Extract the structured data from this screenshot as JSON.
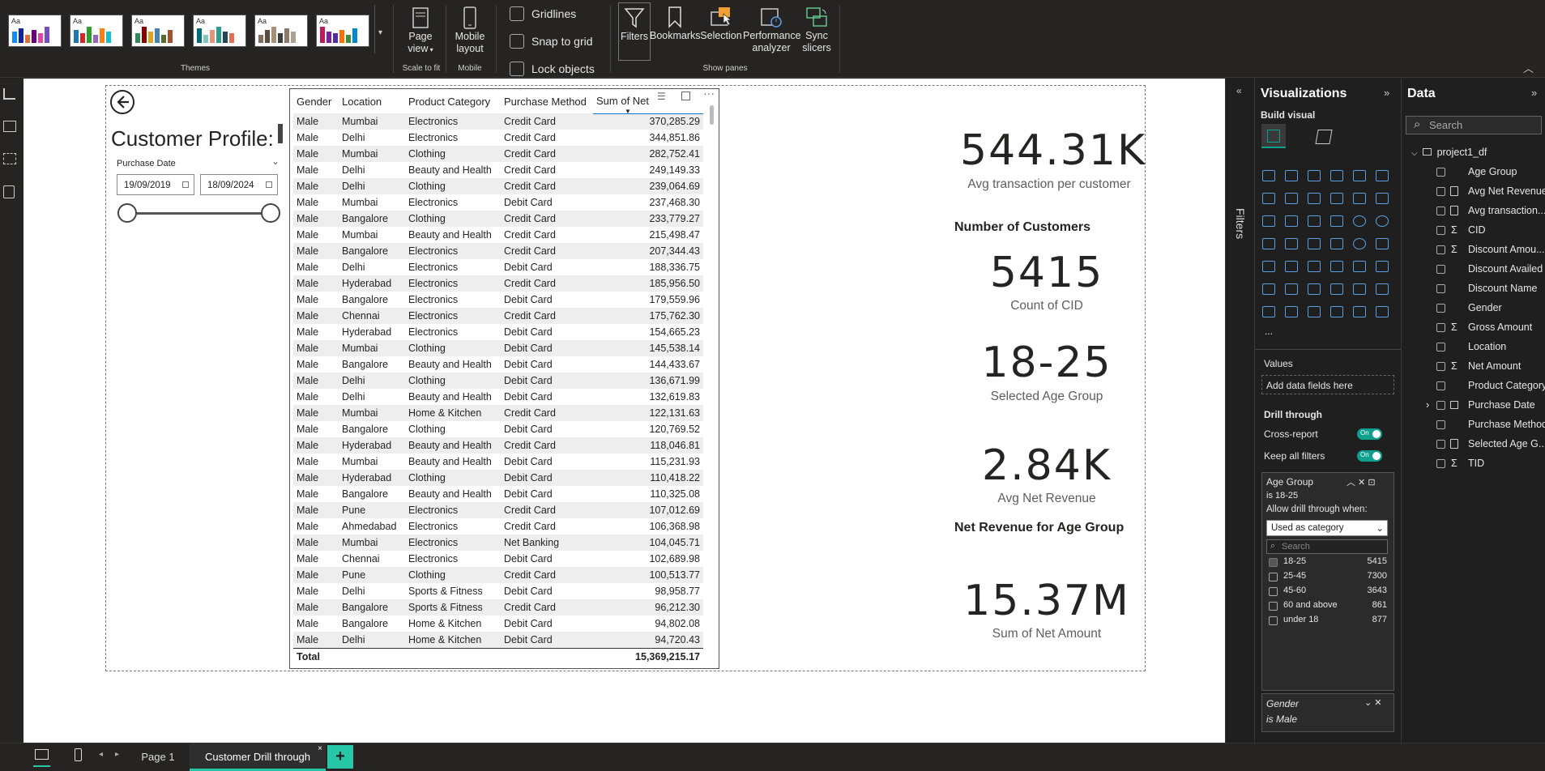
{
  "ribbon": {
    "themes_label": "Themes",
    "page_view_label": "Page view",
    "scale_label": "Scale to fit",
    "mobile_layout_label": "Mobile layout",
    "mobile_group_label": "Mobile",
    "gridlines_label": "Gridlines",
    "snap_label": "Snap to grid",
    "lock_label": "Lock objects",
    "filters_label": "Filters",
    "bookmarks_label": "Bookmarks",
    "selection_label": "Selection",
    "performance_label": "Performance analyzer",
    "sync_label": "Sync slicers",
    "show_panes_label": "Show panes",
    "theme_swatch_text": "Aa"
  },
  "report": {
    "title": "Customer Profile:",
    "slicer_label": "Purchase Date",
    "date_from": "19/09/2019",
    "date_to": "18/09/2024"
  },
  "table": {
    "headers": [
      "Gender",
      "Location",
      "Product Category",
      "Purchase Method",
      "Sum of Net"
    ],
    "rows": [
      [
        "Male",
        "Mumbai",
        "Electronics",
        "Credit Card",
        "370,285.29"
      ],
      [
        "Male",
        "Delhi",
        "Electronics",
        "Credit Card",
        "344,851.86"
      ],
      [
        "Male",
        "Mumbai",
        "Clothing",
        "Credit Card",
        "282,752.41"
      ],
      [
        "Male",
        "Delhi",
        "Beauty and Health",
        "Credit Card",
        "249,149.33"
      ],
      [
        "Male",
        "Delhi",
        "Clothing",
        "Credit Card",
        "239,064.69"
      ],
      [
        "Male",
        "Mumbai",
        "Electronics",
        "Debit Card",
        "237,468.30"
      ],
      [
        "Male",
        "Bangalore",
        "Clothing",
        "Credit Card",
        "233,779.27"
      ],
      [
        "Male",
        "Mumbai",
        "Beauty and Health",
        "Credit Card",
        "215,498.47"
      ],
      [
        "Male",
        "Bangalore",
        "Electronics",
        "Credit Card",
        "207,344.43"
      ],
      [
        "Male",
        "Delhi",
        "Electronics",
        "Debit Card",
        "188,336.75"
      ],
      [
        "Male",
        "Hyderabad",
        "Electronics",
        "Credit Card",
        "185,956.50"
      ],
      [
        "Male",
        "Bangalore",
        "Electronics",
        "Debit Card",
        "179,559.96"
      ],
      [
        "Male",
        "Chennai",
        "Electronics",
        "Credit Card",
        "175,762.30"
      ],
      [
        "Male",
        "Hyderabad",
        "Electronics",
        "Debit Card",
        "154,665.23"
      ],
      [
        "Male",
        "Mumbai",
        "Clothing",
        "Debit Card",
        "145,538.14"
      ],
      [
        "Male",
        "Bangalore",
        "Beauty and Health",
        "Debit Card",
        "144,433.67"
      ],
      [
        "Male",
        "Delhi",
        "Clothing",
        "Debit Card",
        "136,671.99"
      ],
      [
        "Male",
        "Delhi",
        "Beauty and Health",
        "Debit Card",
        "132,619.83"
      ],
      [
        "Male",
        "Mumbai",
        "Home & Kitchen",
        "Credit Card",
        "122,131.63"
      ],
      [
        "Male",
        "Bangalore",
        "Clothing",
        "Debit Card",
        "120,769.52"
      ],
      [
        "Male",
        "Hyderabad",
        "Beauty and Health",
        "Credit Card",
        "118,046.81"
      ],
      [
        "Male",
        "Mumbai",
        "Beauty and Health",
        "Debit Card",
        "115,231.93"
      ],
      [
        "Male",
        "Hyderabad",
        "Clothing",
        "Debit Card",
        "110,418.22"
      ],
      [
        "Male",
        "Bangalore",
        "Beauty and Health",
        "Debit Card",
        "110,325.08"
      ],
      [
        "Male",
        "Pune",
        "Electronics",
        "Credit Card",
        "107,012.69"
      ],
      [
        "Male",
        "Ahmedabad",
        "Electronics",
        "Credit Card",
        "106,368.98"
      ],
      [
        "Male",
        "Mumbai",
        "Electronics",
        "Net Banking",
        "104,045.71"
      ],
      [
        "Male",
        "Chennai",
        "Electronics",
        "Debit Card",
        "102,689.98"
      ],
      [
        "Male",
        "Pune",
        "Clothing",
        "Credit Card",
        "100,513.77"
      ],
      [
        "Male",
        "Delhi",
        "Sports & Fitness",
        "Debit Card",
        "98,958.77"
      ],
      [
        "Male",
        "Bangalore",
        "Sports & Fitness",
        "Credit Card",
        "96,212.30"
      ],
      [
        "Male",
        "Bangalore",
        "Home & Kitchen",
        "Debit Card",
        "94,802.08"
      ],
      [
        "Male",
        "Delhi",
        "Home & Kitchen",
        "Debit Card",
        "94,720.43"
      ]
    ],
    "total_label": "Total",
    "total_value": "15,369,215.17"
  },
  "cards": {
    "avg_txn_value": "544.31K",
    "avg_txn_label": "Avg transaction per customer",
    "customers_title": "Number of Customers",
    "count_value": "5415",
    "count_label": "Count of CID",
    "age_value": "18-25",
    "age_label": "Selected Age Group",
    "avg_net_value": "2.84K",
    "avg_net_label": "Avg Net Revenue",
    "net_rev_title": "Net Revenue for Age Group",
    "sum_net_value": "15.37M",
    "sum_net_label": "Sum of Net Amount"
  },
  "filters_strip_label": "Filters",
  "viz_pane": {
    "title": "Visualizations",
    "build_visual": "Build visual",
    "values_label": "Values",
    "add_fields": "Add data fields here",
    "drill_through": "Drill through",
    "cross_report": "Cross-report",
    "keep_all_filters": "Keep all filters",
    "toggle_on": "On",
    "more": "...",
    "filter_card": {
      "title": "Age Group",
      "subtitle": "is 18-25",
      "allow_text": "Allow drill through when:",
      "dropdown_value": "Used as category",
      "search_placeholder": "Search",
      "options": [
        {
          "label": "18-25",
          "count": "5415"
        },
        {
          "label": "25-45",
          "count": "7300"
        },
        {
          "label": "45-60",
          "count": "3643"
        },
        {
          "label": "60 and above",
          "count": "861"
        },
        {
          "label": "under 18",
          "count": "877"
        }
      ]
    },
    "gender_card": {
      "title": "Gender",
      "subtitle": "is Male"
    }
  },
  "data_pane": {
    "title": "Data",
    "search_placeholder": "Search",
    "table_name": "project1_df",
    "fields": [
      "Age Group",
      "Avg Net Revenue",
      "Avg transaction...",
      "CID",
      "Discount Amou...",
      "Discount Availed",
      "Discount Name",
      "Gender",
      "Gross Amount",
      "Location",
      "Net Amount",
      "Product Category",
      "Purchase Date",
      "Purchase Method",
      "Selected Age G...",
      "TID"
    ]
  },
  "bottom": {
    "page1": "Page 1",
    "page2": "Customer Drill through"
  },
  "colors": {
    "accent": "#0e9f8e",
    "tab_active": "#26c6a6",
    "visual_blue": "#5aa0e0"
  }
}
